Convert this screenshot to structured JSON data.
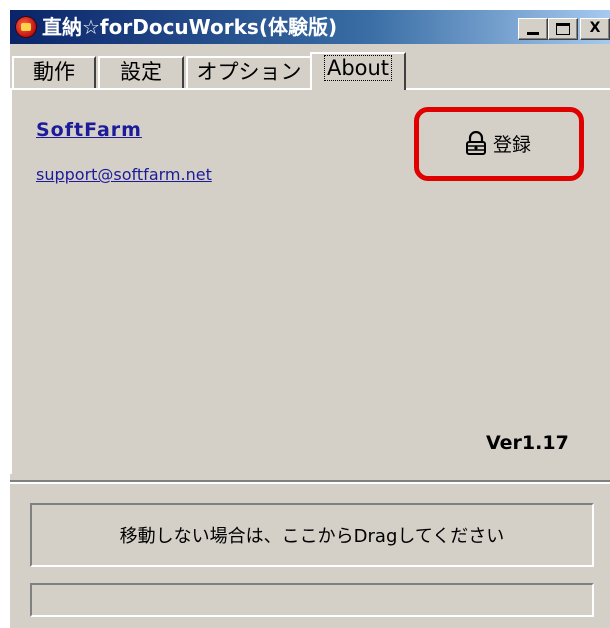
{
  "window": {
    "title": "直納☆forDocuWorks(体験版)",
    "minimize_label": "",
    "maximize_label": "",
    "close_label": "X"
  },
  "tabs": [
    {
      "label": "動作",
      "active": false
    },
    {
      "label": "設定",
      "active": false
    },
    {
      "label": "オプション",
      "active": false
    },
    {
      "label": "About",
      "active": true
    }
  ],
  "about": {
    "company": "SoftFarm",
    "email": "support@softfarm.net",
    "register_label": "登録",
    "register_icon": "lock-icon",
    "version": "Ver1.17"
  },
  "drag_area": {
    "text": "移動しない場合は、ここからDragしてください"
  },
  "status": {
    "text": ""
  },
  "colors": {
    "window_bg": "#d4d0c8",
    "title_bar": "#0a246a",
    "link": "#1c1c9a",
    "highlight": "#e00000"
  }
}
